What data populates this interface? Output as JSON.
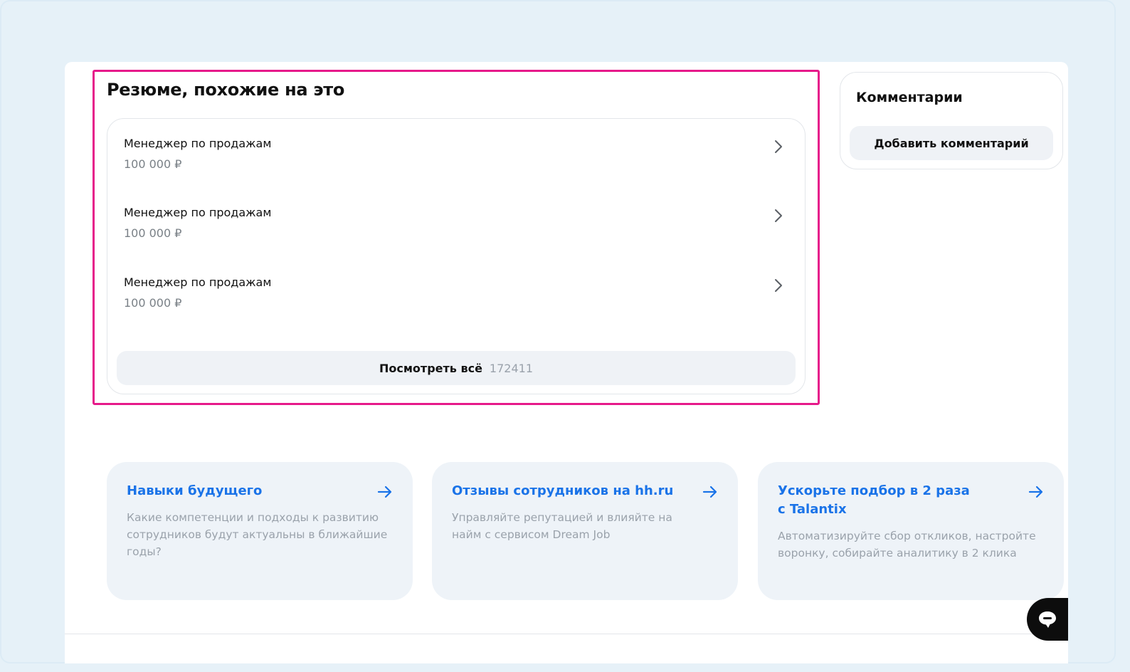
{
  "similar_resumes": {
    "title": "Резюме, похожие на это",
    "items": [
      {
        "title": "Менеджер по продажам",
        "salary": "100 000 ₽"
      },
      {
        "title": "Менеджер по продажам",
        "salary": "100 000 ₽"
      },
      {
        "title": "Менеджер по продажам",
        "salary": "100 000 ₽"
      }
    ],
    "view_all_label": "Посмотреть всё",
    "view_all_count": "172411"
  },
  "comments": {
    "title": "Комментарии",
    "add_label": "Добавить комментарий"
  },
  "promos": [
    {
      "title": "Навыки будущего",
      "description": "Какие компетенции и подходы к развитию сотрудников будут актуальны в ближайшие годы?"
    },
    {
      "title": "Отзывы сотрудников на hh.ru",
      "description": "Управляйте репутацией и влияйте на найм с сервисом Dream Job"
    },
    {
      "title": "Ускорьте подбор в 2 раза с Talantix",
      "description": "Автоматизируйте сбор откликов, настройте воронку, собирайте аналитику в 2 клика"
    }
  ],
  "icons": {
    "item_chevron": "chevron-right-icon",
    "promo_arrow": "arrow-right-icon",
    "chat": "chat-bubble-icon"
  },
  "colors": {
    "highlight": "#e6198a",
    "link": "#1a73e8",
    "muted": "#9aa2ab",
    "background": "#e6f1f8"
  }
}
